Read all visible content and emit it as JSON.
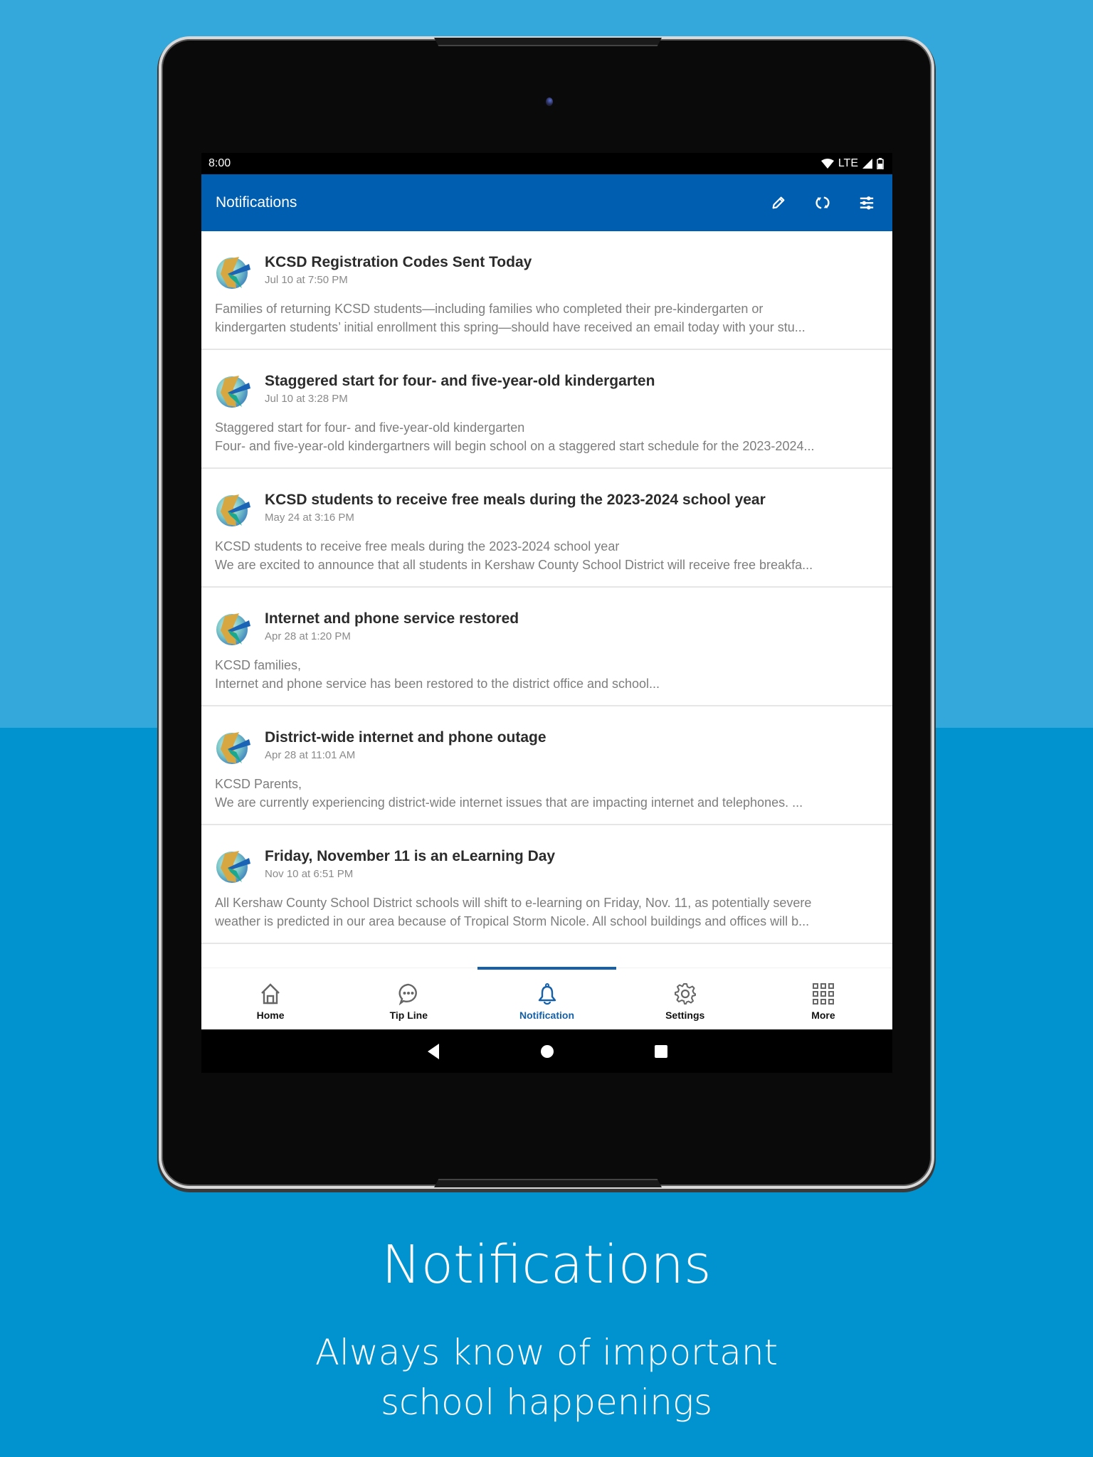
{
  "colors": {
    "background_top": "#34a8da",
    "background_bottom": "#0093cf",
    "appbar": "#005eb0",
    "active_tab": "#1560a8"
  },
  "statusbar": {
    "time": "8:00",
    "network": "LTE",
    "icons": [
      "wifi-icon",
      "signal-icon",
      "battery-icon"
    ]
  },
  "appbar": {
    "title": "Notifications",
    "actions": [
      {
        "name": "edit",
        "icon": "pencil-icon"
      },
      {
        "name": "refresh",
        "icon": "refresh-icon"
      },
      {
        "name": "filter",
        "icon": "sliders-icon"
      }
    ]
  },
  "notifications": [
    {
      "title": "KCSD Registration Codes Sent Today",
      "date": "Jul 10 at 7:50 PM",
      "line1": "Families of returning KCSD students—including families who completed their pre-kindergarten or",
      "line2": "kindergarten students’ initial enrollment this spring—should have received an email today with your stu..."
    },
    {
      "title": "Staggered start for four- and five-year-old kindergarten",
      "date": "Jul 10 at 3:28 PM",
      "line1": "Staggered start for four- and five-year-old kindergarten",
      "line2": "Four- and five-year-old kindergartners will begin school on a staggered start schedule for the 2023-2024..."
    },
    {
      "title": "KCSD students to receive free meals during the 2023-2024 school year",
      "date": "May 24 at 3:16 PM",
      "line1": "KCSD students to receive free meals during the 2023-2024 school year",
      "line2": "We are excited to announce that all students in Kershaw County School District will receive free breakfa..."
    },
    {
      "title": "Internet and phone service restored",
      "date": "Apr 28 at 1:20 PM",
      "line1": "KCSD families,",
      "line2": "Internet and phone service has been restored to the district office and school..."
    },
    {
      "title": "District-wide internet and phone outage",
      "date": "Apr 28 at 11:01 AM",
      "line1": "KCSD Parents,",
      "line2": "We are currently experiencing district-wide internet issues that are impacting internet and telephones. ..."
    },
    {
      "title": "Friday, November 11 is an eLearning Day",
      "date": "Nov 10 at 6:51 PM",
      "line1": "All Kershaw County School District schools will shift to e-learning on Friday, Nov. 11, as potentially severe",
      "line2": "weather is predicted in our area because of Tropical Storm Nicole. All school buildings and offices will b..."
    }
  ],
  "bottom_nav": {
    "active": "Notification",
    "tabs": [
      {
        "label": "Home",
        "icon": "home-icon"
      },
      {
        "label": "Tip Line",
        "icon": "chat-bubble-icon"
      },
      {
        "label": "Notification",
        "icon": "bell-icon"
      },
      {
        "label": "Settings",
        "icon": "gear-icon"
      },
      {
        "label": "More",
        "icon": "grid-icon"
      }
    ]
  },
  "system_nav": [
    "back",
    "home",
    "recents"
  ],
  "caption": {
    "title": "Notifications",
    "subtitle_line1": "Always know of important",
    "subtitle_line2": "school happenings"
  }
}
